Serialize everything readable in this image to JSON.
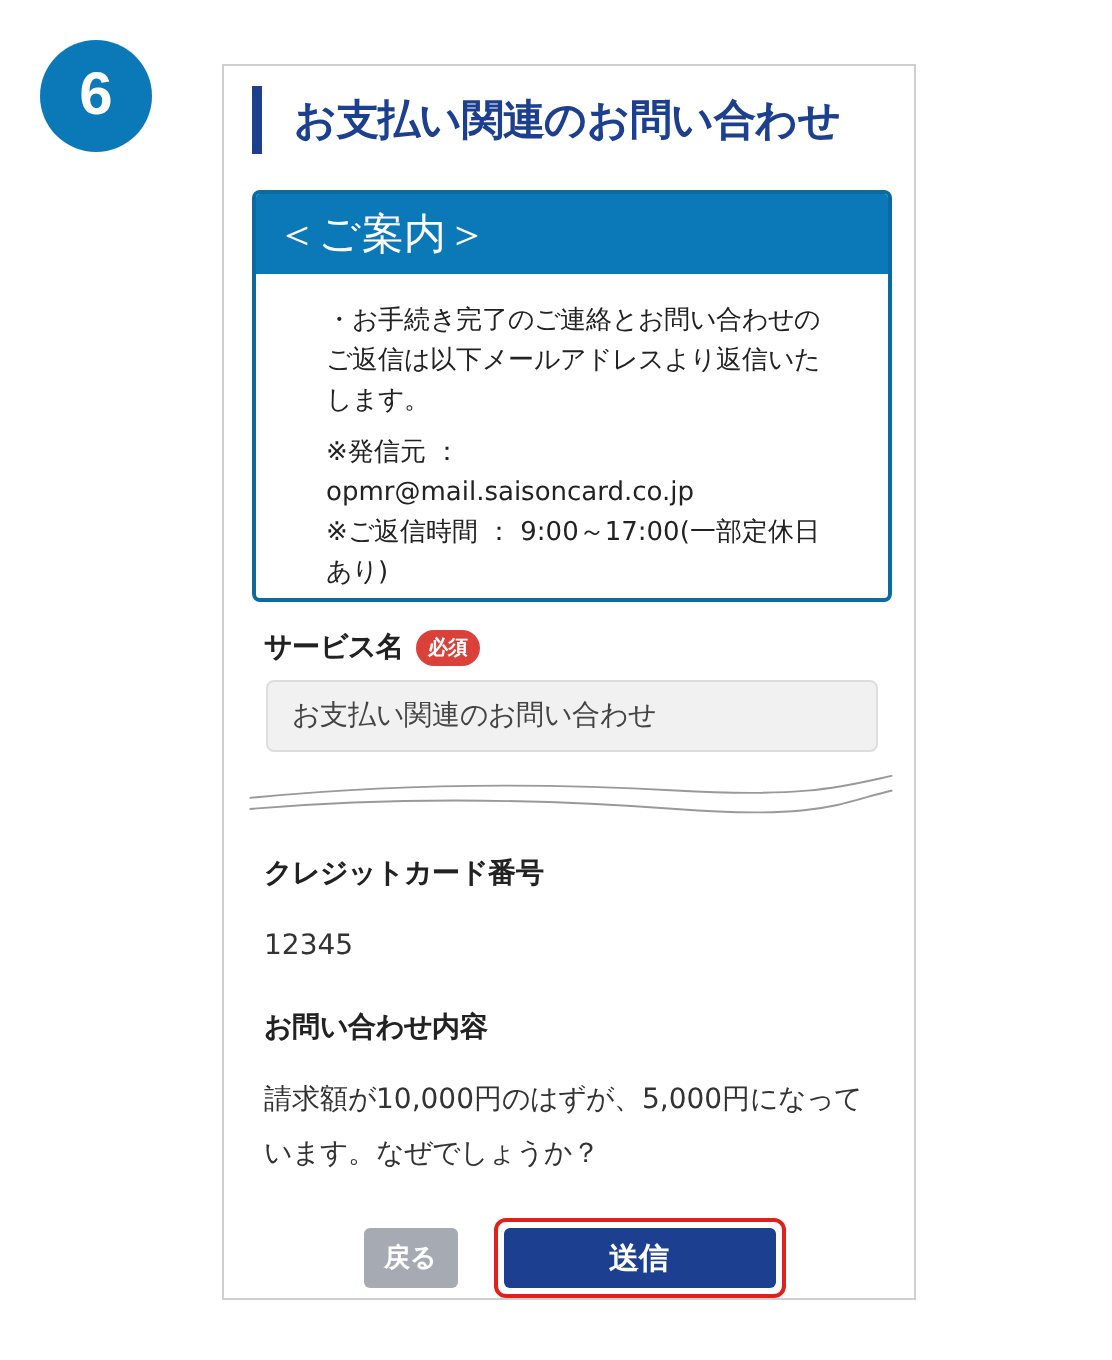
{
  "step": "6",
  "title": "お支払い関連のお問い合わせ",
  "notice": {
    "heading": "＜ご案内＞",
    "paragraphs": [
      "・お手続き完了のご連絡とお問い合わせのご返信は以下メールアドレスより返信いたします。",
      "※発信元 ： opmr@mail.saisoncard.co.jp\n※ご返信時間 ： 9:00～17:00(一部定休日あり)"
    ]
  },
  "service": {
    "label": "サービス名",
    "badge": "必須",
    "value": "お支払い関連のお問い合わせ"
  },
  "fields": [
    {
      "label": "クレジットカード番号",
      "value": "12345"
    },
    {
      "label": "お問い合わせ内容",
      "value": "請求額が10,000円のはずが、5,000円になっています。なぜでしょうか？"
    }
  ],
  "buttons": [
    {
      "kind": "back",
      "label": "戻る",
      "highlighted": false
    },
    {
      "kind": "submit",
      "label": "送信",
      "highlighted": true
    }
  ]
}
